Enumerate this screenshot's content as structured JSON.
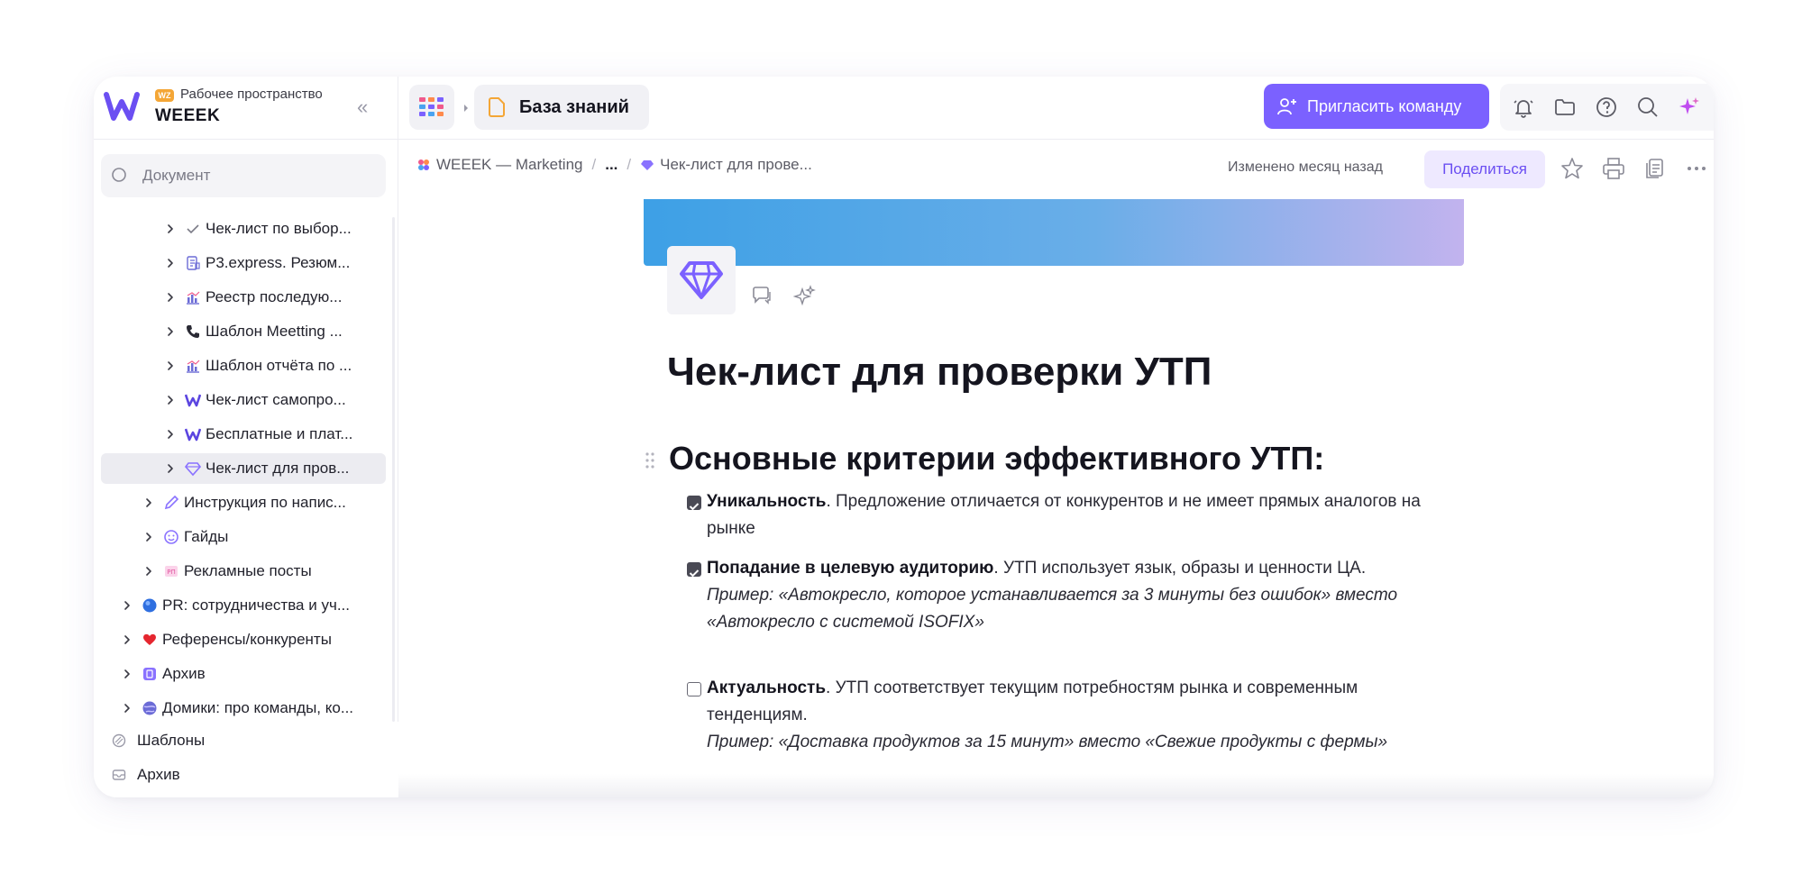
{
  "workspace": {
    "badge": "WZ",
    "subtitle": "Рабочее пространство",
    "name": "WEEEK",
    "collapse_symbol": "«"
  },
  "search": {
    "placeholder": "Документ"
  },
  "tree": [
    {
      "label": "Чек-лист по выбор...",
      "icon": "check-icon",
      "active": false
    },
    {
      "label": "P3.express. Резюм...",
      "icon": "document-icon",
      "active": false
    },
    {
      "label": "Реестр последую...",
      "icon": "chart-icon",
      "active": false
    },
    {
      "label": "Шаблон Meetting ...",
      "icon": "phone-icon",
      "active": false
    },
    {
      "label": "Шаблон отчёта по ...",
      "icon": "chart-icon",
      "active": false
    },
    {
      "label": "Чек-лист самопро...",
      "icon": "weeek-logo-icon",
      "active": false
    },
    {
      "label": "Бесплатные и плат...",
      "icon": "weeek-logo-icon",
      "active": false
    },
    {
      "label": "Чек-лист для пров...",
      "icon": "diamond-icon",
      "active": true
    },
    {
      "label": "Инструкция по напис...",
      "icon": "pen-icon",
      "active": false
    },
    {
      "label": "Гайды",
      "icon": "smile-icon",
      "active": false
    },
    {
      "label": "Рекламные посты",
      "icon": "pink-badge-icon",
      "active": false
    },
    {
      "label": "PR: сотрудничества и уч...",
      "icon": "blue-circle-icon",
      "active": false
    },
    {
      "label": "Референсы/конкуренты",
      "icon": "heart-icon",
      "active": false
    },
    {
      "label": "Архив",
      "icon": "archive-box-icon",
      "active": false
    },
    {
      "label": "Домики: про команды, ко...",
      "icon": "globe-icon",
      "active": false
    }
  ],
  "bottom_links": [
    {
      "label": "Шаблоны",
      "icon": "templates-icon"
    },
    {
      "label": "Архив",
      "icon": "inbox-icon"
    }
  ],
  "topbar": {
    "section": "База знаний",
    "invite_label": "Пригласить команду",
    "tools": [
      "bell-icon",
      "folder-icon",
      "help-icon",
      "search-icon",
      "sparkles-icon",
      "grid-icon"
    ]
  },
  "docbar": {
    "breadcrumb_root": "WEEEK — Marketing",
    "breadcrumb_ellipsis": "...",
    "breadcrumb_current": "Чек-лист для прове...",
    "separator": "/",
    "modified": "Изменено месяц назад",
    "share_label": "Поделиться"
  },
  "document": {
    "title": "Чек-лист для проверки УТП",
    "heading": "Основные критерии эффективного УТП:",
    "items": [
      {
        "checked": true,
        "bold": "Уникальность",
        "text": ". Предложение отличается от конкурентов и не имеет прямых аналогов на рынке",
        "example": ""
      },
      {
        "checked": true,
        "bold": "Попадание в целевую аудиторию",
        "text": ". УТП использует язык, образы и ценности ЦА.",
        "example": "Пример: «Автокресло, которое устанавливается за 3 минуты без ошибок» вместо «Автокресло с системой ISOFIX»"
      },
      {
        "checked": false,
        "bold": "Актуальность",
        "text": ". УТП соответствует текущим потребностям рынка и современным тенденциям.",
        "example": "Пример: «Доставка продуктов за 15 минут» вместо «Свежие продукты с фермы»"
      }
    ]
  },
  "colors": {
    "accent": "#7b61ff",
    "share_bg": "#eee9ff",
    "cover_start": "#3da0e6",
    "cover_end": "#c2b3ee"
  }
}
